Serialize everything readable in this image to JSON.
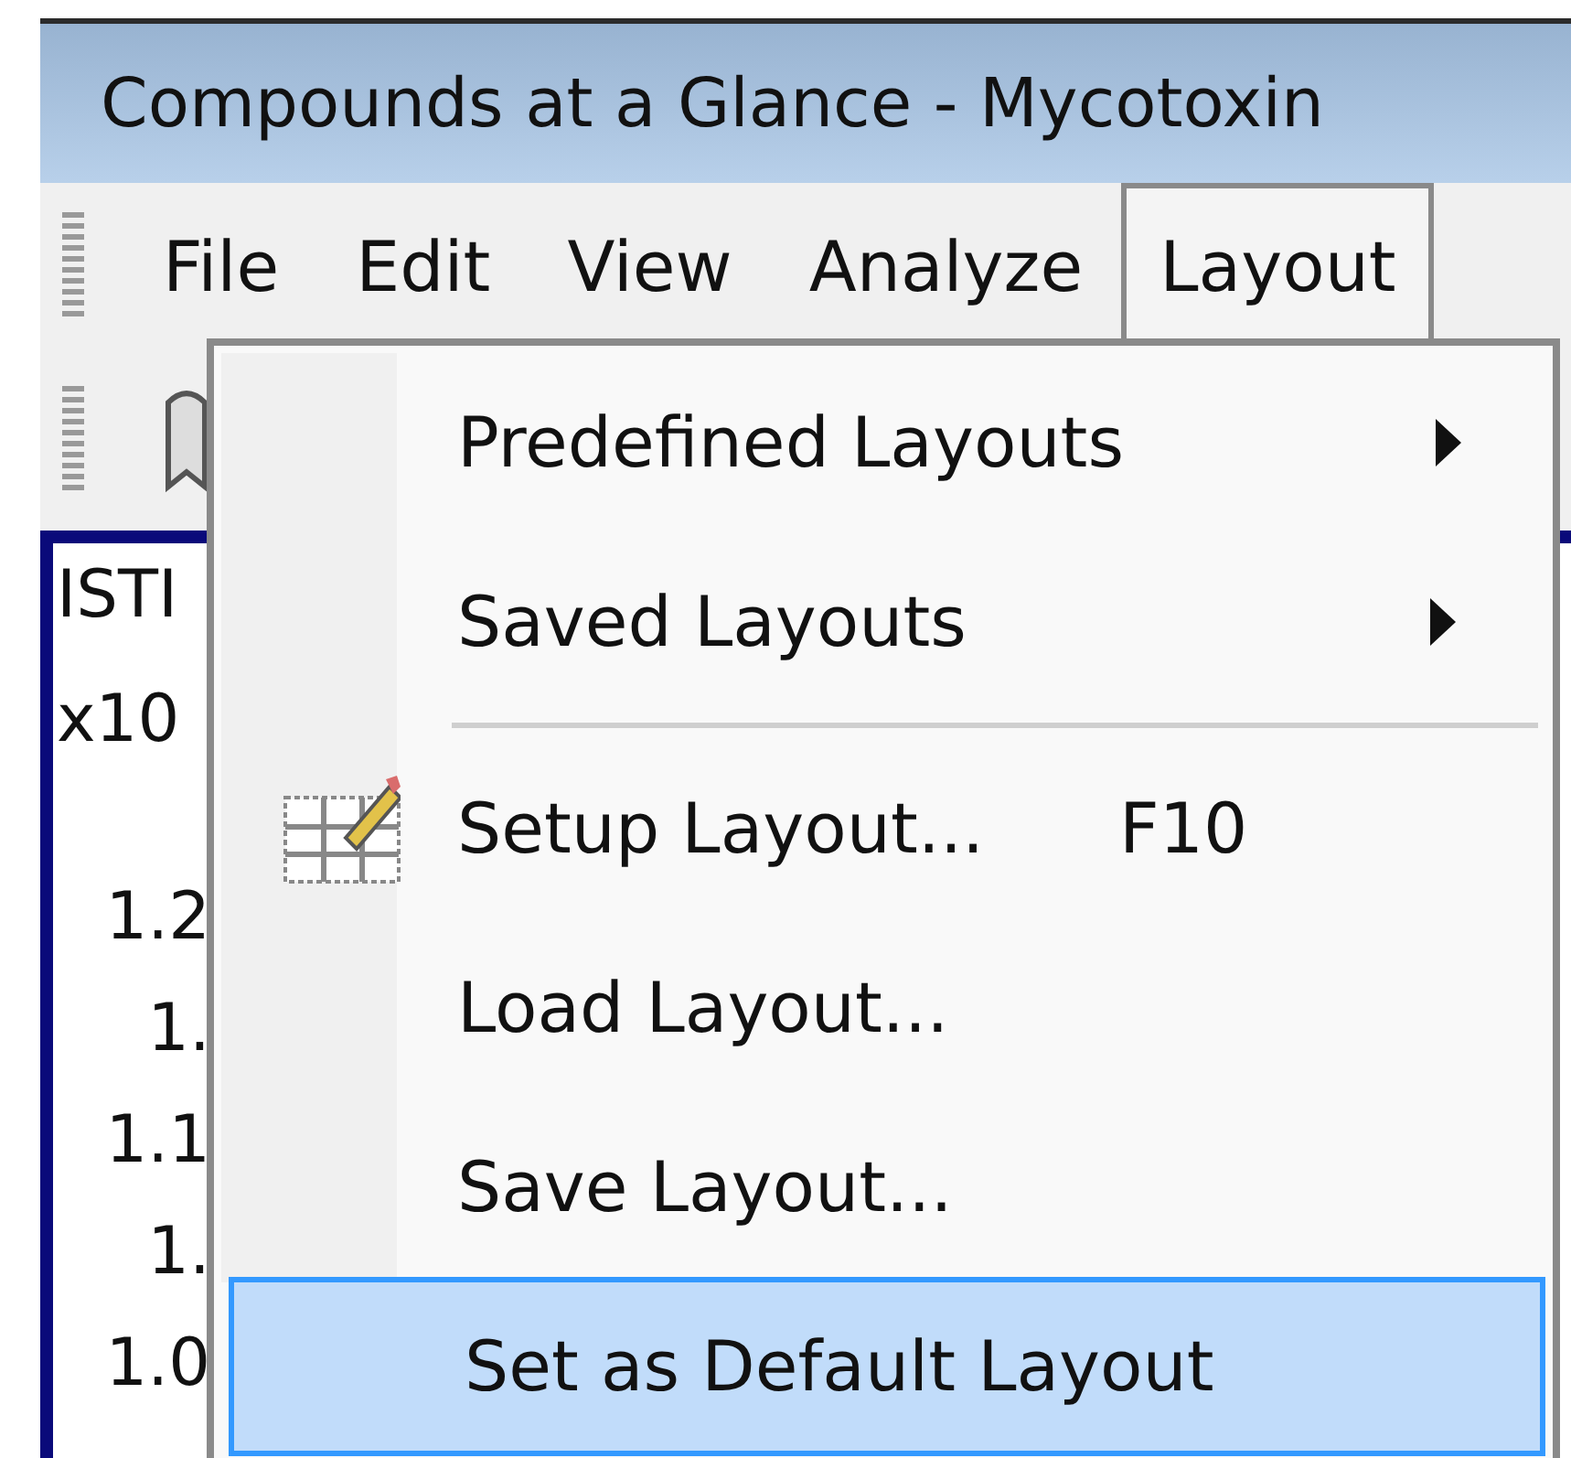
{
  "window": {
    "title": "Compounds at a Glance - Mycotoxin"
  },
  "menubar": [
    {
      "label": "File",
      "selected": false
    },
    {
      "label": "Edit",
      "selected": false
    },
    {
      "label": "View",
      "selected": false
    },
    {
      "label": "Analyze",
      "selected": false
    },
    {
      "label": "Layout",
      "selected": true
    }
  ],
  "plot": {
    "title": "ISTI",
    "exponent": "x10",
    "ticks": [
      "1.2",
      "1.",
      "1.1",
      "1.",
      "1.0"
    ]
  },
  "menu": [
    {
      "kind": "submenu",
      "label": "Predefined Layouts",
      "selected": false
    },
    {
      "kind": "submenu",
      "label": "Saved Layouts",
      "selected": false
    },
    {
      "kind": "separator"
    },
    {
      "kind": "command-with-icon",
      "label": "Setup Layout...",
      "shortcut": "F10",
      "selected": false
    },
    {
      "kind": "command",
      "label": "Load Layout...",
      "selected": false
    },
    {
      "kind": "command",
      "label": "Save Layout...",
      "selected": false
    },
    {
      "kind": "command",
      "label": "Set as Default Layout",
      "selected": true
    }
  ]
}
